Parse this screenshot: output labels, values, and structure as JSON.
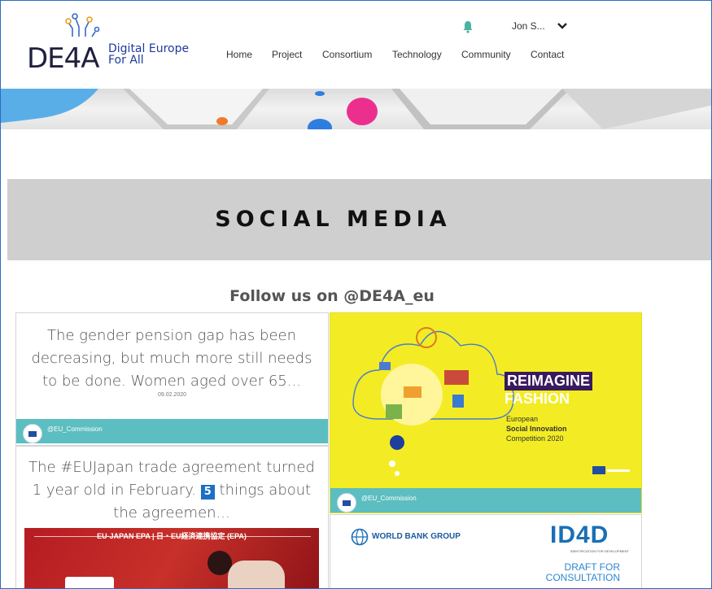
{
  "header": {
    "logo_main": "DE4A",
    "logo_line1": "Digital Europe",
    "logo_line2": "For All",
    "user_name": "Jon S...",
    "nav": [
      "Home",
      "Project",
      "Consortium",
      "Technology",
      "Community",
      "Contact"
    ]
  },
  "band": {
    "title": "SOCIAL MEDIA"
  },
  "follow": "Follow us on @DE4A_eu",
  "cards": [
    {
      "text": "The gender pension gap has been decreasing, but much more still needs to be done. Women aged over 65...",
      "date": "09.02.2020",
      "handle": "@EU_Commission"
    },
    {
      "text_before": "The #EUJapan trade agreement turned 1 year old in February.",
      "emoji_number": "5",
      "text_after": "things about the agreemen...",
      "image_caption": "EU-JAPAN EPA | 日・EU経済連携協定 (EPA)"
    },
    {
      "poster_title1": "REIMAGINE",
      "poster_title2": "FASHION",
      "poster_line1": "European",
      "poster_line2": "Social Innovation",
      "poster_line3": "Competition 2020",
      "handle": "@EU_Commission"
    },
    {
      "org": "WORLD BANK GROUP",
      "brand": "ID4D",
      "brand_sub": "IDENTIFICATION FOR DEVELOPMENT",
      "draft1": "DRAFT FOR",
      "draft2": "CONSULTATION"
    }
  ],
  "colors": {
    "teal_bar": "#5cbec0",
    "poster_yellow": "#f3ec24",
    "brand_blue": "#1e3a9e",
    "wb_blue": "#1a6fb5"
  },
  "icons": [
    "bell-icon",
    "chevron-down-icon"
  ]
}
